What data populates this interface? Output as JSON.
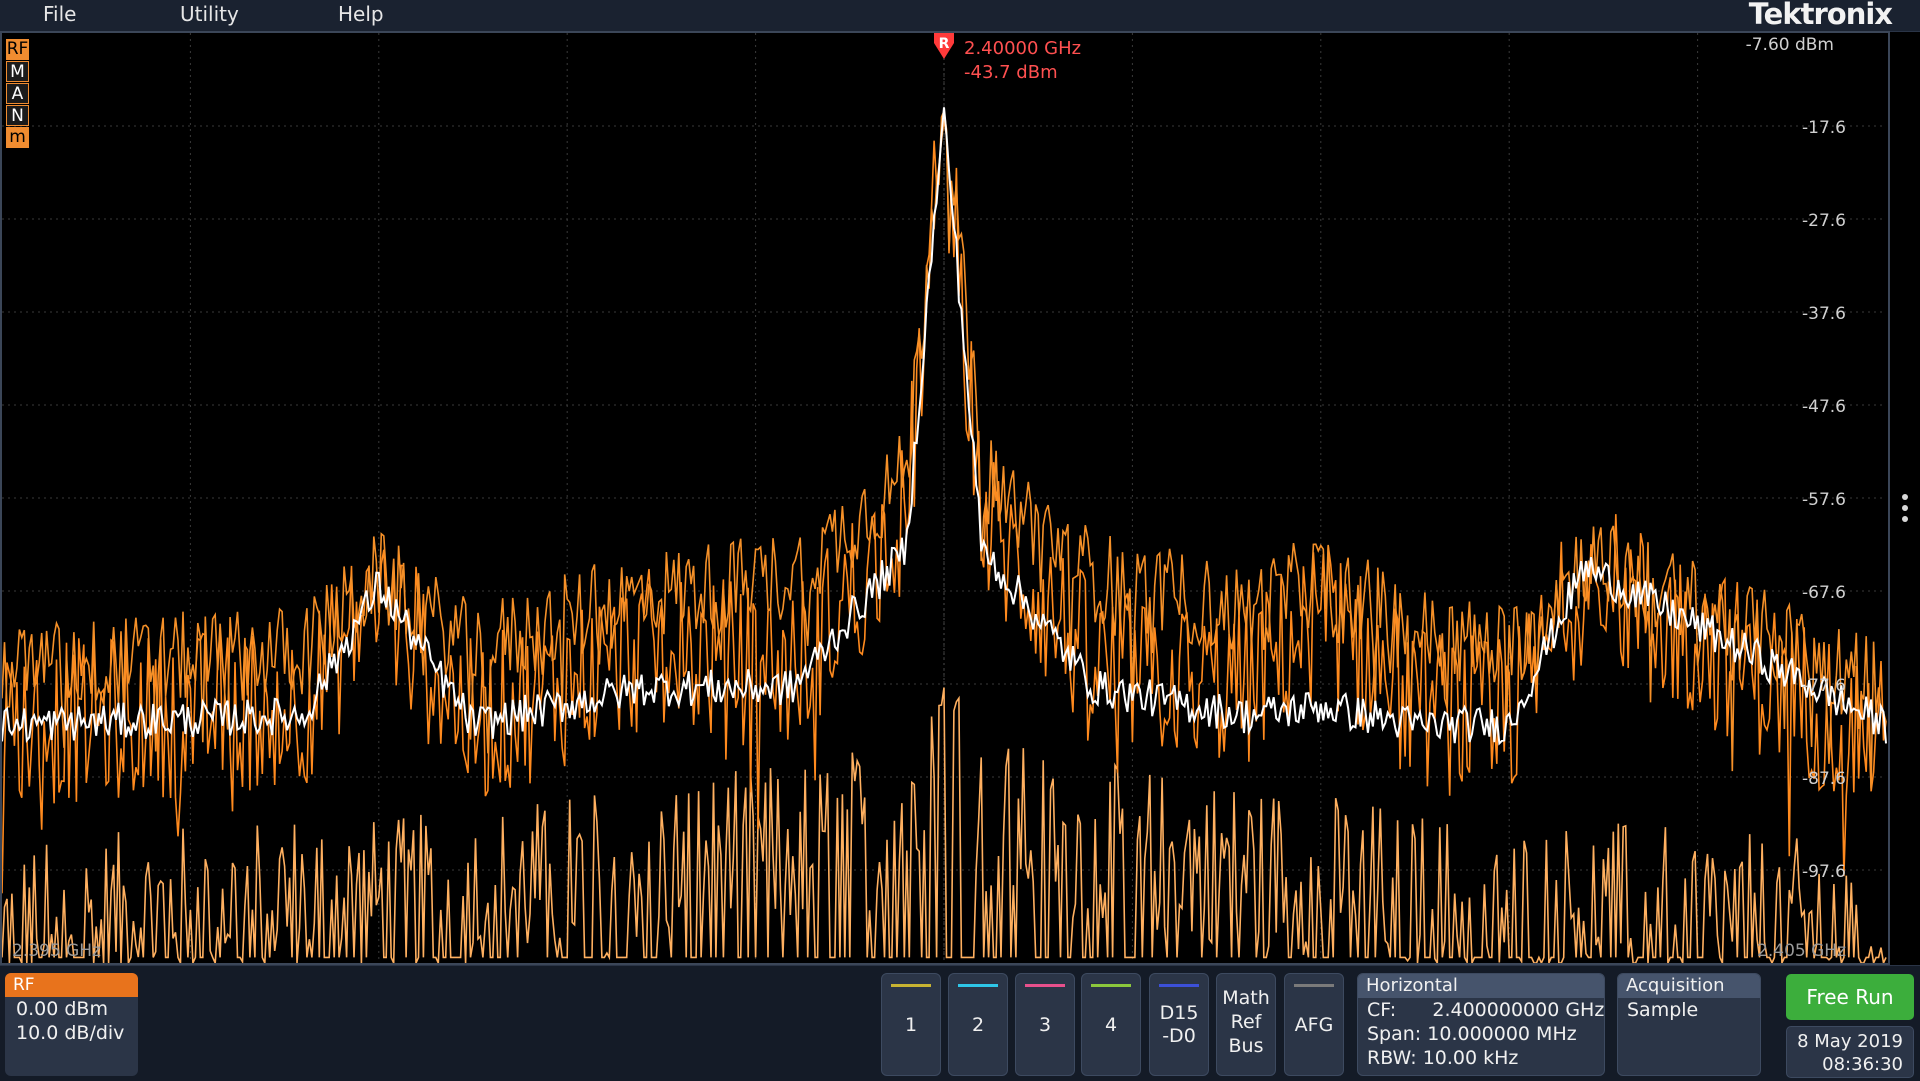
{
  "menu": {
    "file": "File",
    "utility": "Utility",
    "help": "Help"
  },
  "brand": "Tektronix",
  "plot": {
    "ref_level": "-7.60 dBm",
    "y_labels": [
      "-17.6",
      "-27.6",
      "-37.6",
      "-47.6",
      "-57.6",
      "-67.6",
      "-77.6",
      "-87.6",
      "-97.6"
    ],
    "x_start": "2.395 GHz",
    "x_stop": "2.405 GHz",
    "trace_chips": [
      "RF",
      "M",
      "A",
      "N",
      "m"
    ],
    "marker": {
      "symbol": "R",
      "freq": "2.40000 GHz",
      "amp": "-43.7 dBm"
    },
    "colors": {
      "max_trace": "#f59028",
      "normal_trace": "#ff8a1e",
      "avg_trace": "#ffffff",
      "min_trace": "#ffb060",
      "marker": "#ff3a3a"
    }
  },
  "chart_data": {
    "type": "line",
    "title": "",
    "xlabel": "",
    "ylabel": "",
    "xlim": [
      2.395,
      2.405
    ],
    "ylim": [
      -107.6,
      -7.6
    ],
    "x_unit": "GHz",
    "y_unit": "dBm",
    "series": [
      {
        "name": "",
        "kind": "max-hold",
        "x": [
          2.395,
          2.3966,
          2.397,
          2.3975,
          2.3984,
          2.3992,
          2.3998,
          2.4,
          2.4002,
          2.4008,
          2.4016,
          2.402,
          2.4025,
          2.403,
          2.4034,
          2.405
        ],
        "y": [
          -76,
          -74,
          -66,
          -74,
          -68,
          -66,
          -55,
          -15,
          -55,
          -66,
          -70,
          -66,
          -72,
          -74,
          -64,
          -78
        ]
      },
      {
        "name": "",
        "kind": "normal",
        "x": [
          2.395,
          2.3966,
          2.397,
          2.3975,
          2.3984,
          2.3992,
          2.3998,
          2.4,
          2.4002,
          2.4008,
          2.4016,
          2.402,
          2.4025,
          2.403,
          2.4034,
          2.405
        ],
        "y": [
          -82,
          -80,
          -68,
          -82,
          -74,
          -76,
          -60,
          -16,
          -60,
          -76,
          -78,
          -70,
          -80,
          -82,
          -66,
          -84
        ]
      },
      {
        "name": "",
        "kind": "average",
        "x": [
          2.395,
          2.3966,
          2.397,
          2.3975,
          2.3984,
          2.3992,
          2.3998,
          2.4,
          2.4002,
          2.4008,
          2.4016,
          2.402,
          2.4025,
          2.403,
          2.4034,
          2.405
        ],
        "y": [
          -82,
          -81,
          -67,
          -82,
          -78,
          -78,
          -63,
          -16,
          -63,
          -78,
          -81,
          -80,
          -82,
          -82,
          -65,
          -82
        ]
      },
      {
        "name": "",
        "kind": "min-hold",
        "x": [
          2.395,
          2.3966,
          2.397,
          2.3975,
          2.3984,
          2.3992,
          2.3998,
          2.4,
          2.4002,
          2.4008,
          2.4016,
          2.402,
          2.4025,
          2.403,
          2.4034,
          2.405
        ],
        "y": [
          -104,
          -100,
          -101,
          -100,
          -97,
          -95,
          -92,
          -78,
          -92,
          -95,
          -97,
          -98,
          -100,
          -102,
          -101,
          -104
        ]
      }
    ],
    "grid": true,
    "legend": "none"
  },
  "rf": {
    "title": "RF",
    "ref": "0.00 dBm",
    "scale": "10.0 dB/div"
  },
  "channels": [
    {
      "label": "1",
      "color": "#c8b432"
    },
    {
      "label": "2",
      "color": "#2ec6e8"
    },
    {
      "label": "3",
      "color": "#e8508c"
    },
    {
      "label": "4",
      "color": "#8cc83c"
    }
  ],
  "digital": {
    "line1": "D15",
    "line2": "-D0",
    "color": "#3c50d8"
  },
  "mathrefbus": {
    "line1": "Math",
    "line2": "Ref",
    "line3": "Bus"
  },
  "afg": {
    "label": "AFG"
  },
  "horizontal": {
    "title": "Horizontal",
    "cf_label": "CF:",
    "cf_value": "2.400000000 GHz",
    "span_label": "Span:",
    "span_value": "10.000000 MHz",
    "rbw_label": "RBW:",
    "rbw_value": "10.00 kHz"
  },
  "acquisition": {
    "title": "Acquisition",
    "mode": "Sample"
  },
  "trigger": {
    "label": "Free Run"
  },
  "datetime": {
    "date": "8 May 2019",
    "time": "08:36:30"
  }
}
